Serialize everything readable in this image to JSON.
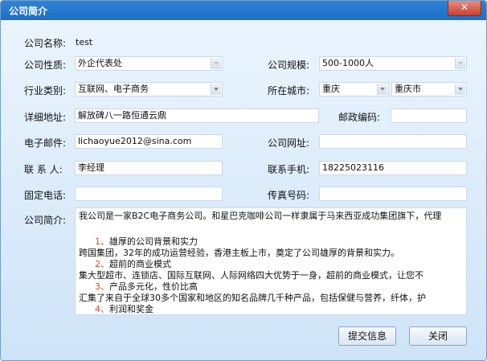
{
  "window": {
    "title": "公司简介",
    "close_glyph": "✕"
  },
  "form": {
    "company_name": {
      "label": "公司名称:",
      "value": "test"
    },
    "company_type": {
      "label": "公司性质:",
      "value": "外企代表处"
    },
    "company_size": {
      "label": "公司规模:",
      "value": "500-1000人"
    },
    "industry": {
      "label": "行业类别:",
      "value": "互联网、电子商务"
    },
    "city": {
      "label": "所在城市:",
      "province": "重庆",
      "city": "重庆市"
    },
    "address": {
      "label": "详细地址:",
      "value": "解放碑八一路恒通云鼎"
    },
    "postcode": {
      "label": "邮政编码:",
      "value": ""
    },
    "email": {
      "label": "电子邮件:",
      "value": "lichaoyue2012@sina.com"
    },
    "website": {
      "label": "公司网址:",
      "value": ""
    },
    "contact": {
      "label": "联 系 人:",
      "value": "李经理"
    },
    "mobile": {
      "label": "联系手机:",
      "value": "18225023116"
    },
    "phone": {
      "label": "固定电话:",
      "value": ""
    },
    "fax": {
      "label": "传真号码:",
      "value": ""
    },
    "intro": {
      "label": "公司简介:",
      "line1": "我公司是一家B2C电子商务公司。和星巴克咖啡公司一样隶属于马来西亚成功集团旗下，代理",
      "line2_num": "1、",
      "line2": "雄厚的公司背景和实力",
      "line3": "跨国集团，32年的成功运营经验，香港主板上市，奠定了公司雄厚的背景和实力。",
      "line4_num": "2、",
      "line4": "超前的商业模式",
      "line5": "集大型超市、连锁店、国际互联网、人际网络四大优势于一身，超前的商业模式，让您不",
      "line6_num": "3、",
      "line6": "产品多元化，性价比高",
      "line7": "汇集了来自于全球30多个国家和地区的知名品牌几千种产品，包括保健与营养，纤体，护",
      "line8_num": "4、",
      "line8": "利润和奖金"
    }
  },
  "buttons": {
    "submit": "提交信息",
    "close": "关闭"
  }
}
